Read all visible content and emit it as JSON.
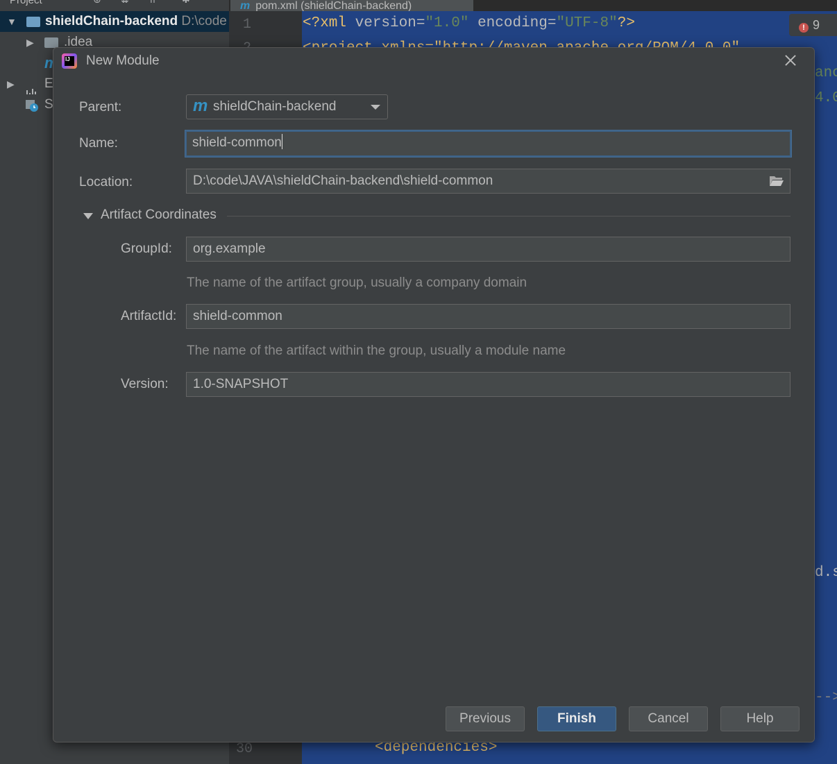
{
  "ide": {
    "project_toolbar": {
      "title": "Project"
    },
    "tree": {
      "root": {
        "name": "shieldChain-backend",
        "path": "D:\\code"
      },
      "items": [
        {
          "label": ".idea"
        },
        {
          "label": "E"
        },
        {
          "label": "S"
        }
      ]
    },
    "editor": {
      "tab_label": "pom.xml (shieldChain-backend)",
      "line_numbers": [
        "1",
        "2",
        "30"
      ],
      "lines": {
        "l1_open": "<?xml ",
        "l1_attr1": "version=",
        "l1_val1": "\"1.0\"",
        "l1_attr2": " encoding=",
        "l1_val2": "\"UTF-8\"",
        "l1_close": "?>",
        "l2": "<project xmlns=\"http://maven.apache.org/POM/4.0.0\"",
        "l30": "<dependencies>"
      },
      "right_fragments": [
        "anc",
        "4.0",
        "d.s",
        "-->"
      ],
      "error_count": "9"
    }
  },
  "dialog": {
    "title": "New Module",
    "fields": {
      "parent_label": "Parent:",
      "parent_value": "shieldChain-backend",
      "name_label": "Name:",
      "name_value": "shield-common",
      "location_label": "Location:",
      "location_value": "D:\\code\\JAVA\\shieldChain-backend\\shield-common"
    },
    "artifact": {
      "section_title": "Artifact Coordinates",
      "group_label": "GroupId:",
      "group_value": "org.example",
      "group_hint": "The name of the artifact group, usually a company domain",
      "artifact_label": "ArtifactId:",
      "artifact_value": "shield-common",
      "artifact_hint": "The name of the artifact within the group, usually a module name",
      "version_label": "Version:",
      "version_value": "1.0-SNAPSHOT"
    },
    "buttons": {
      "previous": "Previous",
      "finish": "Finish",
      "cancel": "Cancel",
      "help": "Help"
    }
  }
}
